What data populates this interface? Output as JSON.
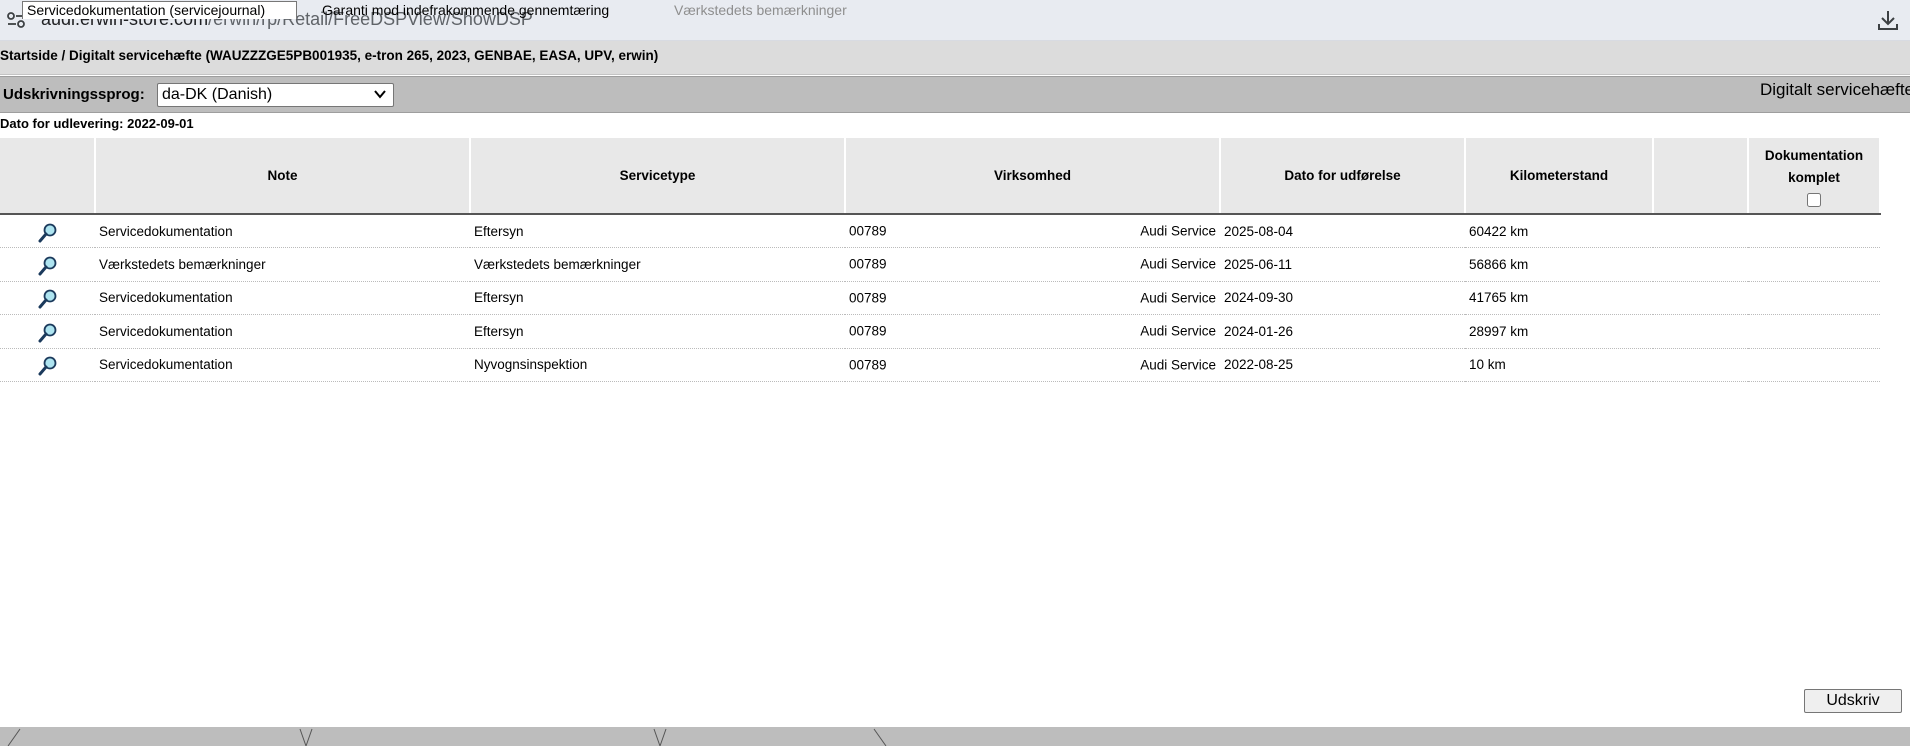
{
  "browser": {
    "url_host": "audi.erwin-store.com",
    "url_path": "/erwin/rp/Retail/FreeDSPView/ShowDSP"
  },
  "breadcrumb": "Startside / Digitalt servicehæfte (WAUZZZGE5PB001935, e-tron 265, 2023, GENBAE, EASA, UPV, erwin)",
  "language": {
    "label": "Udskrivningssprog:",
    "selected": "da-DK (Danish)"
  },
  "page_heading": "Digitalt servicehæfte",
  "delivery_date": "Dato for udlevering: 2022-09-01",
  "table": {
    "headers": {
      "note": "Note",
      "servicetype": "Servicetype",
      "virksomhed": "Virksomhed",
      "dato": "Dato for udførelse",
      "km": "Kilometerstand",
      "extra": "",
      "doc_line1": "Dokumentation",
      "doc_line2": "komplet"
    },
    "rows": [
      {
        "note": "Servicedokumentation",
        "servicetype": "Eftersyn",
        "code": "00789",
        "company": "Audi Service",
        "date": "2025-08-04",
        "km": "60422 km"
      },
      {
        "note": "Værkstedets bemærkninger",
        "servicetype": "Værkstedets bemærkninger",
        "code": "00789",
        "company": "Audi Service",
        "date": "2025-06-11",
        "km": "56866 km"
      },
      {
        "note": "Servicedokumentation",
        "servicetype": "Eftersyn",
        "code": "00789",
        "company": "Audi Service",
        "date": "2024-09-30",
        "km": "41765 km"
      },
      {
        "note": "Servicedokumentation",
        "servicetype": "Eftersyn",
        "code": "00789",
        "company": "Audi Service",
        "date": "2024-01-26",
        "km": "28997 km"
      },
      {
        "note": "Servicedokumentation",
        "servicetype": "Nyvognsinspektion",
        "code": "00789",
        "company": "Audi Service",
        "date": "2022-08-25",
        "km": "10 km"
      }
    ]
  },
  "print_button": "Udskriv",
  "tabs": [
    {
      "label": "Servicedokumentation (servicejournal)"
    },
    {
      "label": "Garanti mod indefrakommende gennemtæring"
    },
    {
      "label": "Værkstedets bemærkninger"
    }
  ],
  "icons": {
    "site_info": "tune-icon",
    "download": "download-icon",
    "row_view": "magnifier-icon",
    "select_chevron": "chevron-down-icon"
  }
}
